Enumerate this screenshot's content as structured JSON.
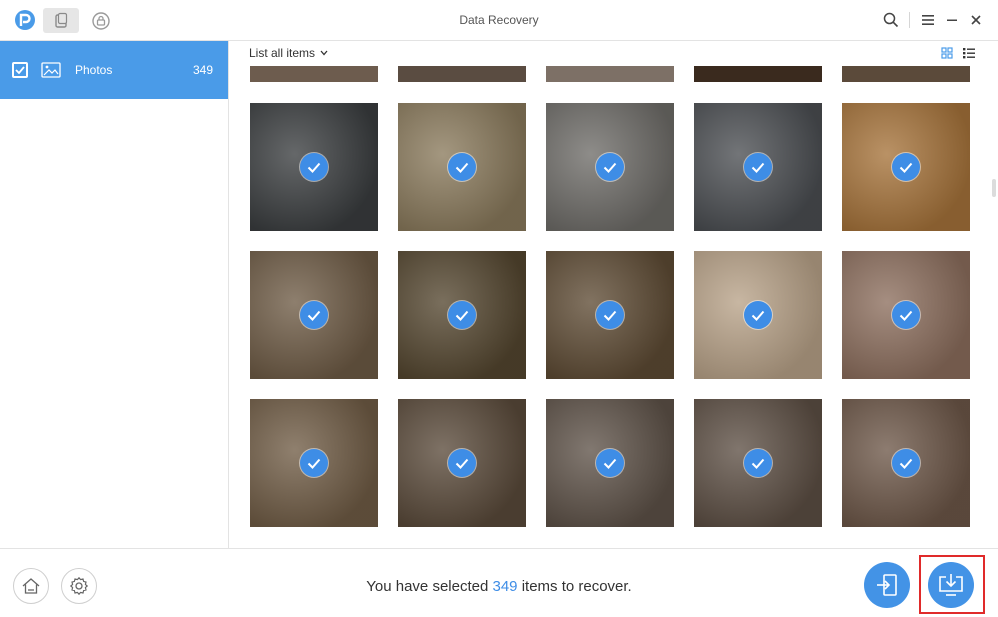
{
  "app": {
    "title": "Data Recovery"
  },
  "sidebar": {
    "items": [
      {
        "label": "Photos",
        "count": "349",
        "checked": true,
        "icon": "image-icon"
      }
    ]
  },
  "list": {
    "header_label": "List all items",
    "view_modes": [
      "grid-view-icon",
      "list-view-icon"
    ]
  },
  "thumbnails": {
    "top_partial_row": [
      "#6d5c4e",
      "#5a4c41",
      "#7d7066",
      "#3a2a1e",
      "#5b4a3a"
    ],
    "rows": [
      [
        "#3a3d3f",
        "#8a7a5c",
        "#6e6c68",
        "#4b4e52",
        "#a6733a"
      ],
      [
        "#6e5b45",
        "#54462f",
        "#5e4b34",
        "#b8a288",
        "#8c6e5d"
      ],
      [
        "#705c45",
        "#5a4a3a",
        "#5e5248",
        "#5d4f44",
        "#6d5748"
      ]
    ]
  },
  "footer": {
    "status_prefix": "You have selected",
    "selected_count": "349",
    "status_suffix": "items to recover."
  },
  "colors": {
    "accent": "#4a9be8",
    "check": "#3e8de6",
    "highlight": "#e02a2a"
  }
}
